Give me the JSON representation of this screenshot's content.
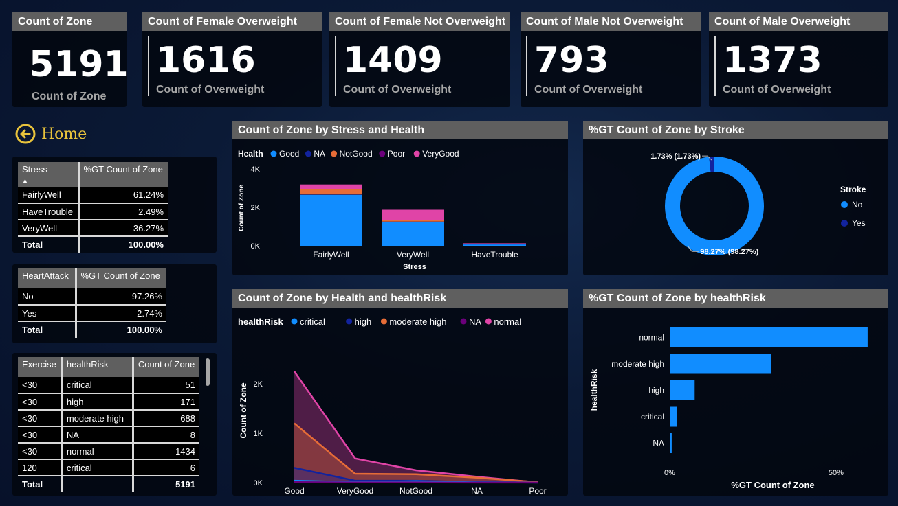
{
  "kpis": [
    {
      "title": "Count of Zone",
      "value": "5191",
      "sub": "Count of Zone"
    },
    {
      "title": "Count of Female Overweight",
      "value": "1616",
      "sub": "Count of Overweight"
    },
    {
      "title": "Count of Female Not Overweight",
      "value": "1409",
      "sub": "Count of Overweight"
    },
    {
      "title": "Count of Male Not Overweight",
      "value": "793",
      "sub": "Count of Overweight"
    },
    {
      "title": "Count of Male Overweight",
      "value": "1373",
      "sub": "Count of Overweight"
    }
  ],
  "home": {
    "label": "Home"
  },
  "stress_table": {
    "headers": [
      "Stress",
      "%GT Count of Zone"
    ],
    "rows": [
      [
        "FairlyWell",
        "61.24%"
      ],
      [
        "HaveTrouble",
        "2.49%"
      ],
      [
        "VeryWell",
        "36.27%"
      ]
    ],
    "total": [
      "Total",
      "100.00%"
    ]
  },
  "heart_table": {
    "headers": [
      "HeartAttack",
      "%GT Count of Zone"
    ],
    "rows": [
      [
        "No",
        "97.26%"
      ],
      [
        "Yes",
        "2.74%"
      ]
    ],
    "total": [
      "Total",
      "100.00%"
    ]
  },
  "exercise_table": {
    "headers": [
      "Exercise",
      "healthRisk",
      "Count of Zone"
    ],
    "rows": [
      [
        "<30",
        "critical",
        "51"
      ],
      [
        "<30",
        "high",
        "171"
      ],
      [
        "<30",
        "moderate high",
        "688"
      ],
      [
        "<30",
        "NA",
        "8"
      ],
      [
        "<30",
        "normal",
        "1434"
      ],
      [
        "120",
        "critical",
        "6"
      ]
    ],
    "total": [
      "Total",
      "",
      "5191"
    ]
  },
  "colors": {
    "blue": "#118dff",
    "navy": "#12239e",
    "orange": "#e66c37",
    "purple": "#6b007b",
    "pink": "#e044a7",
    "panel_head": "#5f5f5f",
    "home": "#e8c33c"
  },
  "chart_data": [
    {
      "type": "bar",
      "stacked": true,
      "title": "Count of Zone by Stress and Health",
      "legend_title": "Health",
      "categories": [
        "FairlyWell",
        "VeryWell",
        "HaveTrouble"
      ],
      "series": [
        {
          "name": "Good",
          "values": [
            2650,
            1250,
            80
          ]
        },
        {
          "name": "NA",
          "values": [
            20,
            10,
            2
          ]
        },
        {
          "name": "NotGood",
          "values": [
            280,
            80,
            20
          ]
        },
        {
          "name": "Poor",
          "values": [
            10,
            5,
            2
          ]
        },
        {
          "name": "VeryGood",
          "values": [
            230,
            530,
            25
          ]
        }
      ],
      "xlabel": "Stress",
      "ylabel": "Count of Zone",
      "yticks": [
        "0K",
        "2K",
        "4K"
      ],
      "ylim": [
        0,
        4000
      ]
    },
    {
      "type": "pie",
      "donut": true,
      "title": "%GT Count of Zone by Stroke",
      "legend_title": "Stroke",
      "slices": [
        {
          "name": "No",
          "value": 98.27,
          "label": "98.27% (98.27%)"
        },
        {
          "name": "Yes",
          "value": 1.73,
          "label": "1.73% (1.73%)"
        }
      ]
    },
    {
      "type": "area",
      "title": "Count of Zone by Health and healthRisk",
      "legend_title": "healthRisk",
      "categories": [
        "Good",
        "VeryGood",
        "NotGood",
        "NA",
        "Poor"
      ],
      "series": [
        {
          "name": "critical",
          "values": [
            40,
            10,
            30,
            5,
            2
          ]
        },
        {
          "name": "high",
          "values": [
            300,
            40,
            40,
            10,
            3
          ]
        },
        {
          "name": "moderate high",
          "values": [
            1200,
            180,
            170,
            100,
            10
          ]
        },
        {
          "name": "NA",
          "values": [
            10,
            5,
            5,
            2,
            1
          ]
        },
        {
          "name": "normal",
          "values": [
            2250,
            490,
            250,
            120,
            5
          ]
        }
      ],
      "xlabel": "Health",
      "ylabel": "Count of Zone",
      "yticks": [
        "0K",
        "1K",
        "2K"
      ],
      "ylim": [
        0,
        2500
      ]
    },
    {
      "type": "bar",
      "orientation": "horizontal",
      "title": "%GT Count of Zone by healthRisk",
      "categories": [
        "normal",
        "moderate high",
        "high",
        "critical",
        "NA"
      ],
      "values": [
        59.5,
        30.5,
        7.5,
        2.2,
        0.6
      ],
      "xlabel": "%GT Count of Zone",
      "ylabel": "healthRisk",
      "xticks": [
        "0%",
        "50%"
      ],
      "xlim": [
        0,
        62
      ]
    }
  ]
}
